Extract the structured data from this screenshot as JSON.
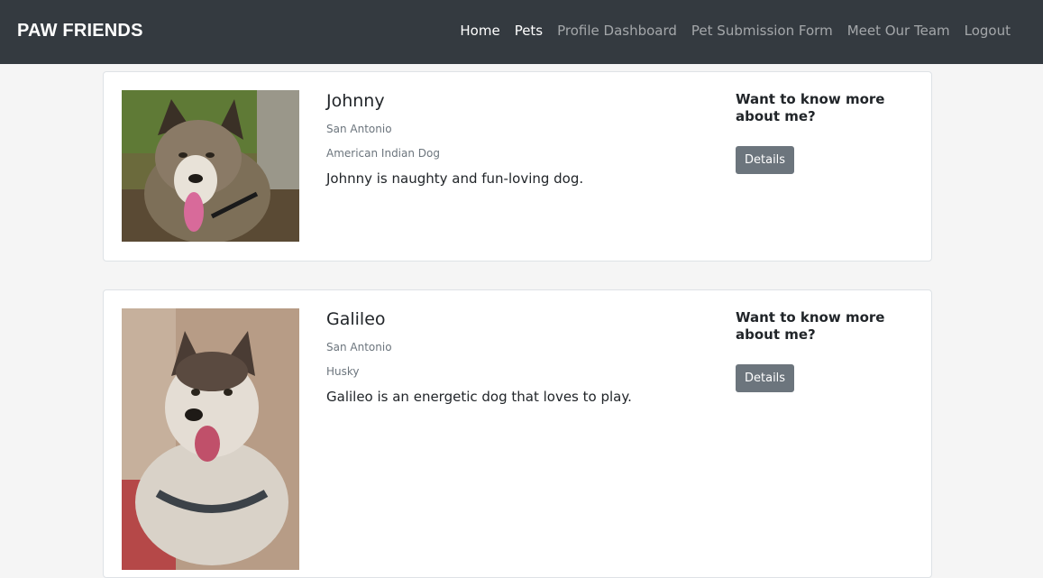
{
  "navbar": {
    "brand": "PAW FRIENDS",
    "links": [
      {
        "label": "Home",
        "active": true
      },
      {
        "label": "Pets",
        "active": true
      },
      {
        "label": "Profile Dashboard",
        "active": false
      },
      {
        "label": "Pet Submission Form",
        "active": false
      },
      {
        "label": "Meet Our Team",
        "active": false
      },
      {
        "label": "Logout",
        "active": false
      }
    ]
  },
  "pets": [
    {
      "name": "Johnny",
      "city": "San Antonio",
      "breed": "American Indian Dog",
      "description": "Johnny is naughty and fun-loving dog.",
      "more_heading": "Want to know more about me?",
      "details_label": "Details",
      "photo_icon": "husky-dog-photo"
    },
    {
      "name": "Galileo",
      "city": "San Antonio",
      "breed": "Husky",
      "description": "Galileo is an energetic dog that loves to play.",
      "more_heading": "Want to know more about me?",
      "details_label": "Details",
      "photo_icon": "husky-dog-photo"
    }
  ],
  "colors": {
    "navbar_bg": "#343a40",
    "page_bg": "#f5f5f5",
    "button_bg": "#6c757d",
    "muted_text": "#6c757d"
  }
}
